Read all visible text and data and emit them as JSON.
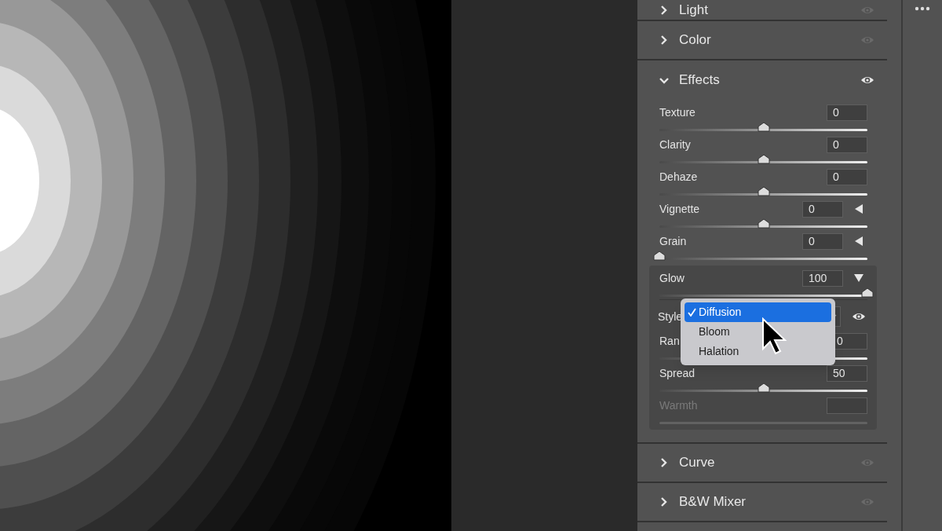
{
  "sections": [
    {
      "label": "Light",
      "expanded": false,
      "eye_on": false
    },
    {
      "label": "Color",
      "expanded": false,
      "eye_on": false
    },
    {
      "label": "Effects",
      "expanded": true,
      "eye_on": true,
      "sliders": [
        {
          "kind": "plain",
          "label": "Texture",
          "value": "0",
          "level": 0.5,
          "disabled": false
        },
        {
          "kind": "plain",
          "label": "Clarity",
          "value": "0",
          "level": 0.5,
          "disabled": false
        },
        {
          "kind": "plain",
          "label": "Dehaze",
          "value": "0",
          "level": 0.5,
          "disabled": false
        },
        {
          "kind": "expandable",
          "label": "Vignette",
          "value": "0",
          "level": 0.5,
          "disabled": false,
          "expanded": false
        },
        {
          "kind": "expandable",
          "label": "Grain",
          "value": "0",
          "level": 0,
          "disabled": false,
          "expanded": false
        },
        {
          "kind": "expandable",
          "label": "Glow",
          "value": "100",
          "level": 1,
          "disabled": false,
          "expanded": true,
          "children": [
            {
              "kind": "dropdown",
              "label": "Style",
              "eye_on": true,
              "menu": [
                {
                  "label": "Diffusion",
                  "selected": true
                },
                {
                  "label": "Bloom",
                  "selected": false
                },
                {
                  "label": "Halation",
                  "selected": false
                }
              ]
            },
            {
              "kind": "plain",
              "label": "Ran",
              "value": "0",
              "disabled": false
            },
            {
              "kind": "plain",
              "label": "Spread",
              "value": "50",
              "level": 0.5,
              "disabled": false
            },
            {
              "kind": "plain",
              "label": "Warmth",
              "disabled": true
            }
          ]
        }
      ]
    },
    {
      "label": "Curve",
      "expanded": false,
      "eye_on": false
    },
    {
      "label": "B&W Mixer",
      "expanded": false,
      "eye_on": false
    }
  ]
}
